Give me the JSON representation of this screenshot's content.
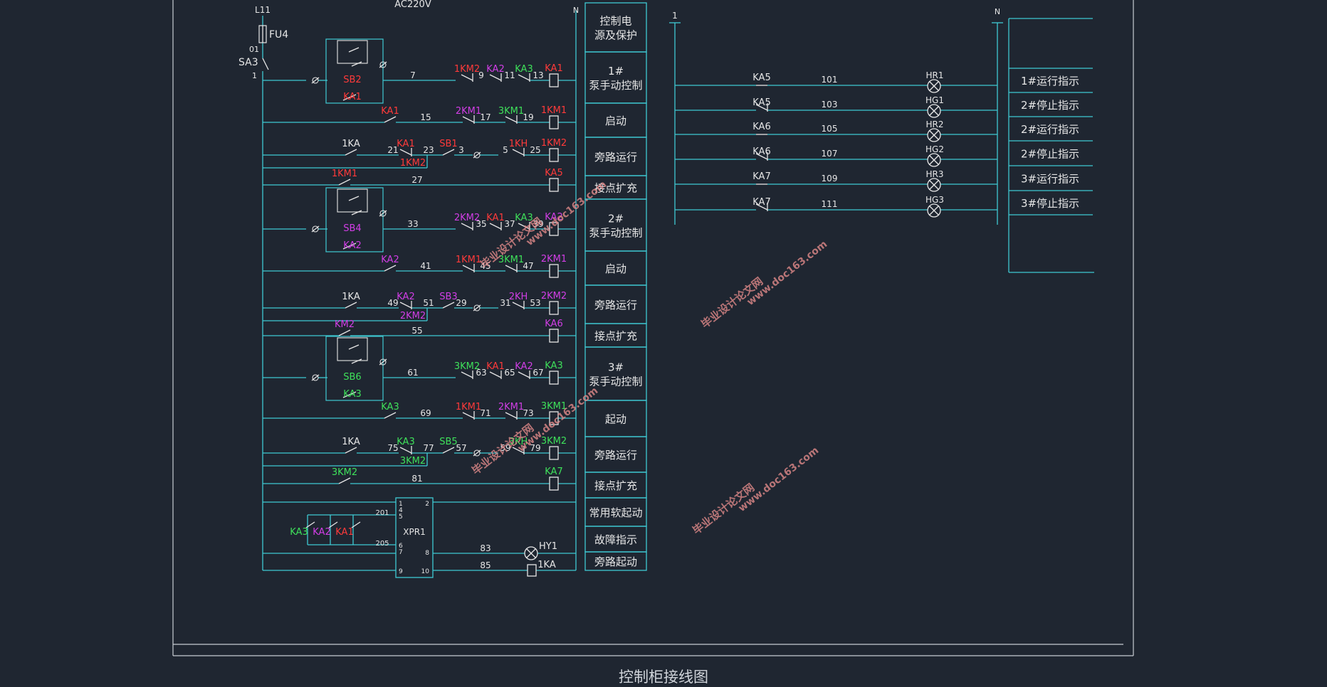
{
  "title": "控制柜接线图",
  "colors": {
    "background": "#1f2631",
    "frame": "#c8ccd2",
    "wire": "#3fc9d3",
    "text": "#e6e6e6",
    "red": "#ff3a3a",
    "magenta": "#d23ee6",
    "green": "#3ee05a",
    "watermark": "#e08a8a"
  },
  "left_circuit": {
    "supply_label": "AC220V",
    "line_label": "L11",
    "neutral_label": "N",
    "fuse_label": "FU4",
    "node_01": "01",
    "switch_label": "SA3",
    "node_1": "1",
    "rungs": [
      {
        "wire": "7",
        "contacts": [
          "1KM2",
          "KA2",
          "KA3"
        ],
        "wires": [
          "9",
          "11",
          "13"
        ],
        "coil": "KA1",
        "buttons": [
          "SB2"
        ],
        "seal": "KA1"
      },
      {
        "seal": "KA1",
        "wire": "15",
        "contacts": [
          "2KM1",
          "3KM1"
        ],
        "wires": [
          "17",
          "19"
        ],
        "coil": "1KM1"
      },
      {
        "seal": "1KA",
        "wires": [
          "21",
          "23",
          "3",
          "5",
          "25"
        ],
        "contacts": [
          "KA1",
          "SB1",
          "1KH"
        ],
        "parallel": "1KM2",
        "coil": "1KM2"
      },
      {
        "seal": "1KM1",
        "wire": "27",
        "coil": "KA5"
      },
      {
        "wire": "33",
        "contacts": [
          "2KM2",
          "KA1",
          "KA3"
        ],
        "wires": [
          "35",
          "37",
          "39"
        ],
        "coil": "KA2",
        "buttons": [
          "SB4"
        ],
        "seal": "KA2"
      },
      {
        "seal": "KA2",
        "wire": "41",
        "contacts": [
          "1KM1",
          "3KM1"
        ],
        "wires": [
          "45",
          "47"
        ],
        "coil": "2KM1"
      },
      {
        "seal": "1KA",
        "wires": [
          "49",
          "51",
          "29",
          "31",
          "53"
        ],
        "contacts": [
          "KA2",
          "SB3",
          "2KH"
        ],
        "parallel": "2KM2",
        "coil": "2KM2"
      },
      {
        "seal": "KM2",
        "wire": "55",
        "coil": "KA6"
      },
      {
        "wire": "61",
        "contacts": [
          "3KM2",
          "KA1",
          "KA2"
        ],
        "wires": [
          "63",
          "65",
          "67"
        ],
        "coil": "KA3",
        "buttons": [
          "SB6"
        ],
        "seal": "KA3"
      },
      {
        "seal": "KA3",
        "wire": "69",
        "contacts": [
          "1KM1",
          "2KM1"
        ],
        "wires": [
          "71",
          "73"
        ],
        "coil": "3KM1"
      },
      {
        "seal": "1KA",
        "wires": [
          "75",
          "77",
          "57",
          "59",
          "79"
        ],
        "contacts": [
          "KA3",
          "SB5",
          "3KH"
        ],
        "parallel": "3KM2",
        "coil": "3KM2"
      },
      {
        "seal": "3KM2",
        "wire": "81",
        "coil": "KA7"
      }
    ],
    "xpr": {
      "label": "XPR1",
      "pins": [
        "1",
        "4",
        "5",
        "2",
        "6",
        "7",
        "8",
        "9",
        "10"
      ],
      "wires": [
        "201",
        "205",
        "83",
        "85"
      ],
      "inputs": [
        "KA3",
        "KA2",
        "KA1"
      ],
      "lamp": "HY1",
      "relay": "1KA"
    }
  },
  "left_table": [
    "控制电\n源及保护",
    "1#\n泵手动控制",
    "启动",
    "旁路运行",
    "接点扩充",
    "2#\n泵手动控制",
    "启动",
    "旁路运行",
    "接点扩充",
    "3#\n泵手动控制",
    "起动",
    "旁路运行",
    "接点扩充",
    "常用软起动",
    "故障指示",
    "旁路起动"
  ],
  "right_circuit": {
    "line_label": "1",
    "neutral_label": "N",
    "rungs": [
      {
        "contact": "KA5",
        "wire": "101",
        "lamp": "HR1"
      },
      {
        "contact": "KA5",
        "wire": "103",
        "lamp": "HG1"
      },
      {
        "contact": "KA6",
        "wire": "105",
        "lamp": "HR2"
      },
      {
        "contact": "KA6",
        "wire": "107",
        "lamp": "HG2"
      },
      {
        "contact": "KA7",
        "wire": "109",
        "lamp": "HR3"
      },
      {
        "contact": "KA7",
        "wire": "111",
        "lamp": "HG3"
      }
    ]
  },
  "right_table": [
    "1#运行指示",
    "2#停止指示",
    "2#运行指示",
    "2#停止指示",
    "3#运行指示",
    "3#停止指示"
  ],
  "watermarks": [
    "毕业设计论文网",
    "www.doc163.com"
  ]
}
